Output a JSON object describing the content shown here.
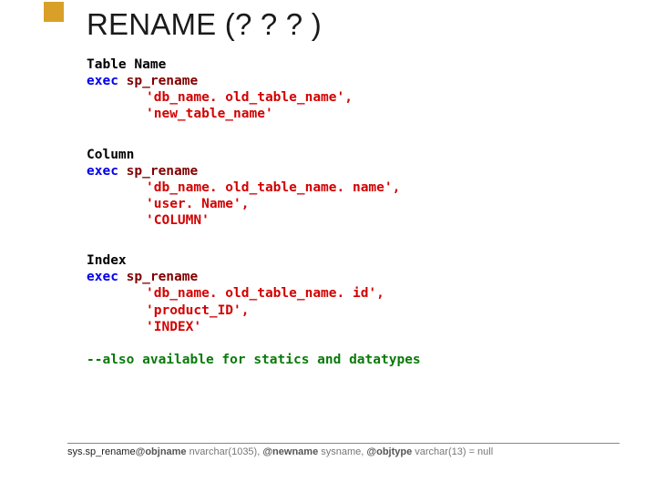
{
  "title": "RENAME (? ? ? )",
  "sections": [
    {
      "label": "Table Name",
      "exec_kw": "exec",
      "sp": "sp_rename",
      "args": [
        "'db_name. old_table_name',",
        "'new_table_name'"
      ]
    },
    {
      "label": "Column",
      "exec_kw": "exec",
      "sp": "sp_rename",
      "args": [
        "'db_name. old_table_name. name',",
        "'user. Name',",
        "'COLUMN'"
      ]
    },
    {
      "label": "Index",
      "exec_kw": "exec",
      "sp": "sp_rename",
      "args": [
        "'db_name. old_table_name. id',",
        "'product_ID',",
        "'INDEX'"
      ]
    }
  ],
  "comment": "--also available for statics and datatypes",
  "footer": {
    "fn": "sys.sp_rename",
    "p1_var": "@objname",
    "p1_type": " nvarchar(1035), ",
    "p2_var": "@newname",
    "p2_type": " sysname, ",
    "p3_var": "@objtype",
    "p3_type": " varchar(13) = null"
  }
}
